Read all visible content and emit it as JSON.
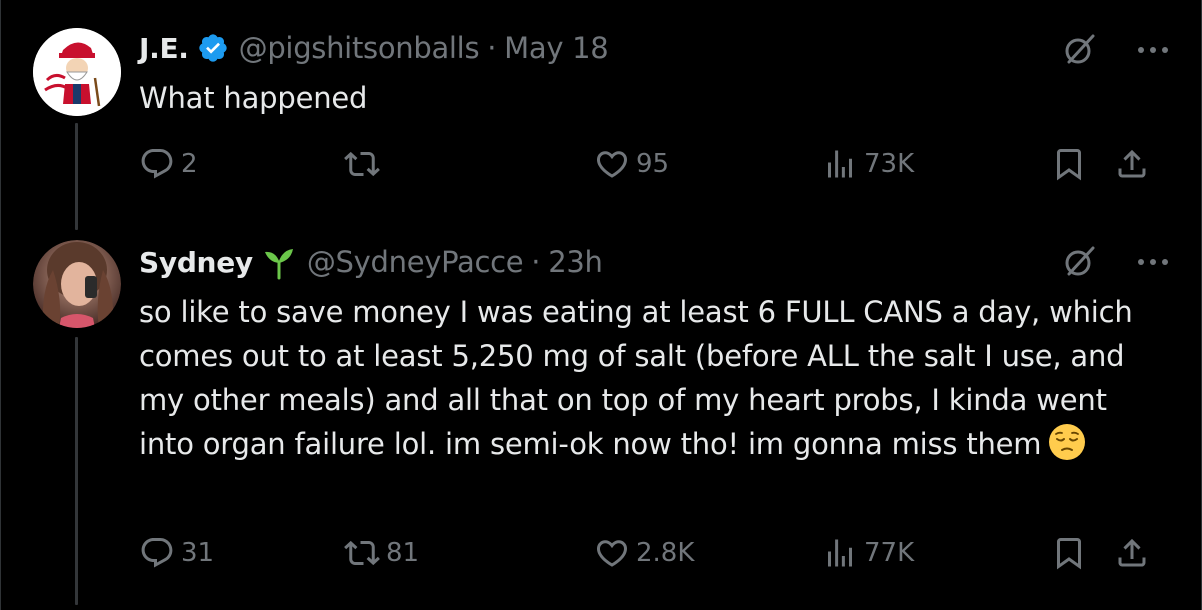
{
  "tweets": [
    {
      "name": "J.E.",
      "handle": "@pigshitsonballs",
      "dot": "·",
      "time": "May 18",
      "text": "What happened",
      "replies": "2",
      "retweets": "",
      "likes": "95",
      "views": "73K",
      "badge": "verified-icon"
    },
    {
      "name": "Sydney",
      "handle": "@SydneyPacce",
      "dot": "·",
      "time": "23h",
      "text": "so like to save money I was eating at least 6 FULL CANS a day, which comes out to at least 5,250 mg of salt (before ALL the salt I use, and my other meals) and all that on top of my heart probs, I kinda went into organ failure lol. im semi-ok now tho! im gonna miss them",
      "replies": "31",
      "retweets": "81",
      "likes": "2.8K",
      "views": "77K",
      "badge": "sprout-icon",
      "emoji": "pensive-face-emoji"
    }
  ],
  "colors": {
    "background": "#000000",
    "text": "#e7e9ea",
    "muted": "#71767b",
    "verified": "#1d9bf0",
    "sprout": "#6bc64a",
    "thread_line": "#333639"
  }
}
